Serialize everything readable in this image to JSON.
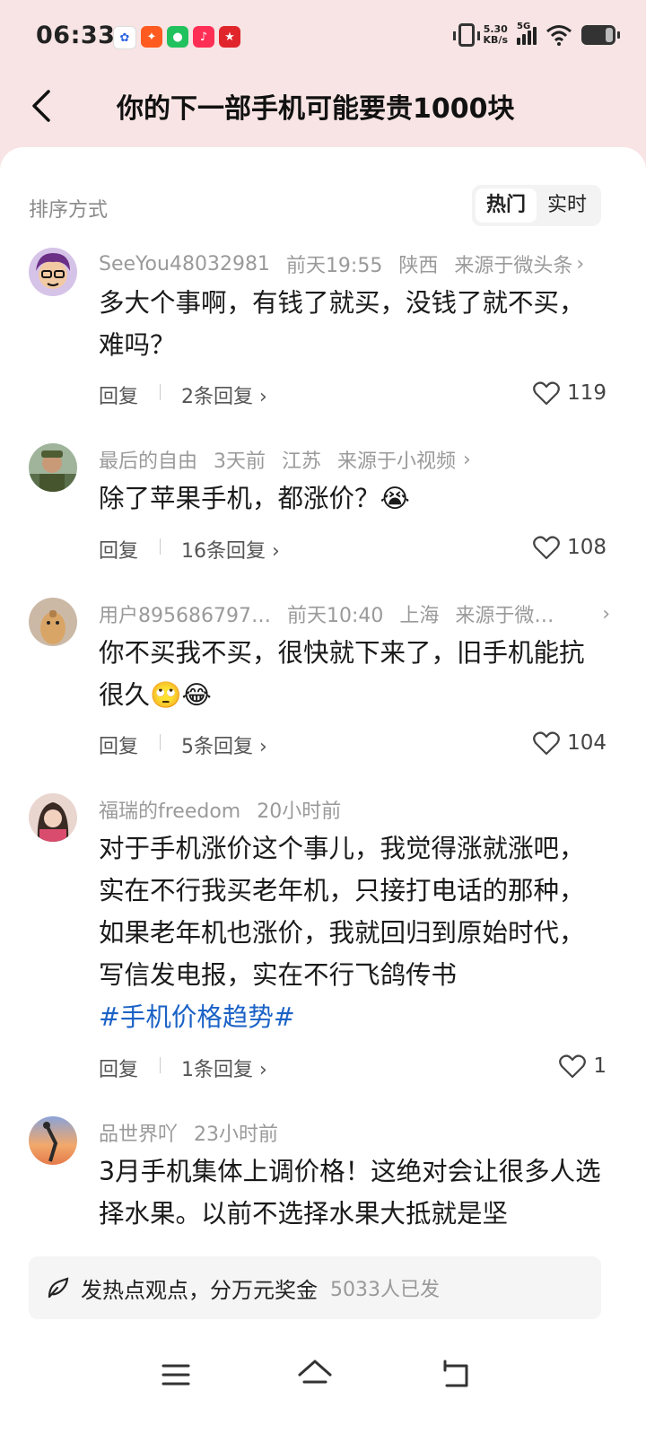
{
  "status_bar": {
    "time": "06:33",
    "net_speed": "5.30",
    "net_unit": "KB/s",
    "network": "5G",
    "app_icons": [
      "baidu-icon",
      "taobao-icon",
      "wechat-icon",
      "douyin-icon",
      "pinduoduo-icon"
    ]
  },
  "header": {
    "title": "你的下一部手机可能要贵1000块"
  },
  "sort": {
    "label": "排序方式",
    "options": [
      "热门",
      "实时"
    ],
    "selected": "热门"
  },
  "comments": [
    {
      "user": "SeeYou48032981",
      "time": "前天19:55",
      "location": "陕西",
      "source": "来源于微头条",
      "text": "多大个事啊，有钱了就买，没钱了就不买，难吗？",
      "reply_label": "回复",
      "replies": "2条回复",
      "likes": "119"
    },
    {
      "user": "最后的自由",
      "time": "3天前",
      "location": "江苏",
      "source": "来源于小视频",
      "text": "除了苹果手机，都涨价？😭",
      "reply_label": "回复",
      "replies": "16条回复",
      "likes": "108"
    },
    {
      "user": "用户895686797…",
      "time": "前天10:40",
      "location": "上海",
      "source": "来源于微…",
      "text": "你不买我不买，很快就下来了，旧手机能抗很久🙄😂",
      "reply_label": "回复",
      "replies": "5条回复",
      "likes": "104"
    },
    {
      "user": "福瑞的freedom",
      "time": "20小时前",
      "text": "对于手机涨价这个事儿，我觉得涨就涨吧，实在不行我买老年机，只接打电话的那种，如果老年机也涨价，我就回归到原始时代，写信发电报，实在不行飞鸽传书",
      "hashtag": "#手机价格趋势#",
      "reply_label": "回复",
      "replies": "1条回复",
      "likes": "1"
    },
    {
      "user": "品世界吖",
      "time": "23小时前",
      "text": "3月手机集体上调价格！这绝对会让很多人选择水果。以前不选择水果大抵就是坚"
    }
  ],
  "post_bar": {
    "text": "发热点观点，分万元奖金",
    "count": "5033人已发"
  },
  "nav": [
    "menu-icon",
    "home-icon",
    "back-icon"
  ]
}
